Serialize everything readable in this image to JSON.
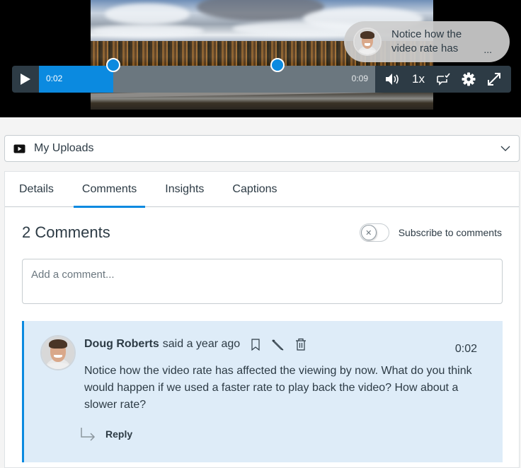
{
  "player": {
    "current_time": "0:02",
    "total_time": "0:09",
    "progress_fraction": 0.22,
    "markers_fraction": [
      0.22,
      0.71
    ],
    "speed": "1x",
    "icons": [
      "play-icon",
      "volume-icon",
      "captions-icon",
      "settings-icon",
      "fullscreen-icon"
    ],
    "bubble": {
      "text": "Notice how the video rate has",
      "more": "..."
    }
  },
  "uploads": {
    "label": "My Uploads",
    "icon": "video-icon"
  },
  "tabs": [
    {
      "label": "Details",
      "active": false
    },
    {
      "label": "Comments",
      "active": true
    },
    {
      "label": "Insights",
      "active": false
    },
    {
      "label": "Captions",
      "active": false
    }
  ],
  "comments_section": {
    "heading": "2 Comments",
    "subscribe_label": "Subscribe to comments",
    "subscribed": false,
    "add_placeholder": "Add a comment..."
  },
  "comments": [
    {
      "author": "Doug Roberts",
      "when": "said a year ago",
      "timestamp": "0:02",
      "body": "Notice how the video rate has affected the viewing by now. What do you think would happen if we used a faster rate to play back the video? How about a slower rate?",
      "reply_label": "Reply"
    }
  ],
  "colors": {
    "accent": "#0b8ae0",
    "dark": "#2d3b45",
    "comment_bg": "#deecf8"
  }
}
